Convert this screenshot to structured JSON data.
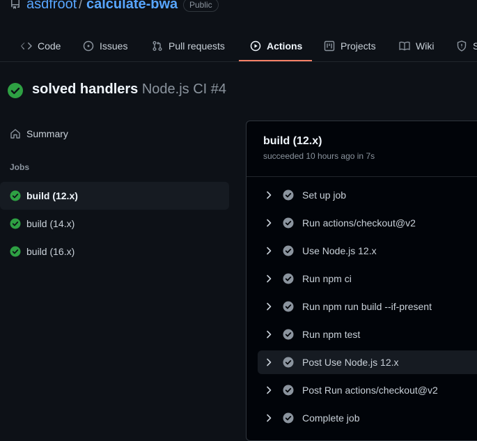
{
  "repo": {
    "owner": "asdfroot",
    "separator": "/",
    "name": "calculate-bwa",
    "visibility": "Public"
  },
  "tabs": [
    {
      "label": "Code",
      "icon": "code-icon"
    },
    {
      "label": "Issues",
      "icon": "issue-icon"
    },
    {
      "label": "Pull requests",
      "icon": "pull-request-icon"
    },
    {
      "label": "Actions",
      "icon": "play-icon",
      "active": true
    },
    {
      "label": "Projects",
      "icon": "project-icon"
    },
    {
      "label": "Wiki",
      "icon": "book-icon"
    },
    {
      "label": "S",
      "icon": "shield-icon"
    }
  ],
  "run": {
    "title": "solved handlers",
    "workflow": "Node.js CI #4"
  },
  "sidebar": {
    "summary_label": "Summary",
    "jobs_label": "Jobs",
    "jobs": [
      {
        "label": "build (12.x)",
        "selected": true
      },
      {
        "label": "build (14.x)"
      },
      {
        "label": "build (16.x)"
      }
    ]
  },
  "job_panel": {
    "title": "build (12.x)",
    "subtitle": "succeeded 10 hours ago in 7s",
    "steps": [
      {
        "label": "Set up job"
      },
      {
        "label": "Run actions/checkout@v2"
      },
      {
        "label": "Use Node.js 12.x"
      },
      {
        "label": "Run npm ci"
      },
      {
        "label": "Run npm run build --if-present"
      },
      {
        "label": "Run npm test"
      },
      {
        "label": "Post Use Node.js 12.x",
        "hover": true
      },
      {
        "label": "Post Run actions/checkout@v2"
      },
      {
        "label": "Complete job"
      }
    ]
  },
  "colors": {
    "background": "#0d1117",
    "link": "#58a6ff",
    "success": "#2ea043",
    "step_check": "#8b949e",
    "active_tab_underline": "#f78166"
  }
}
